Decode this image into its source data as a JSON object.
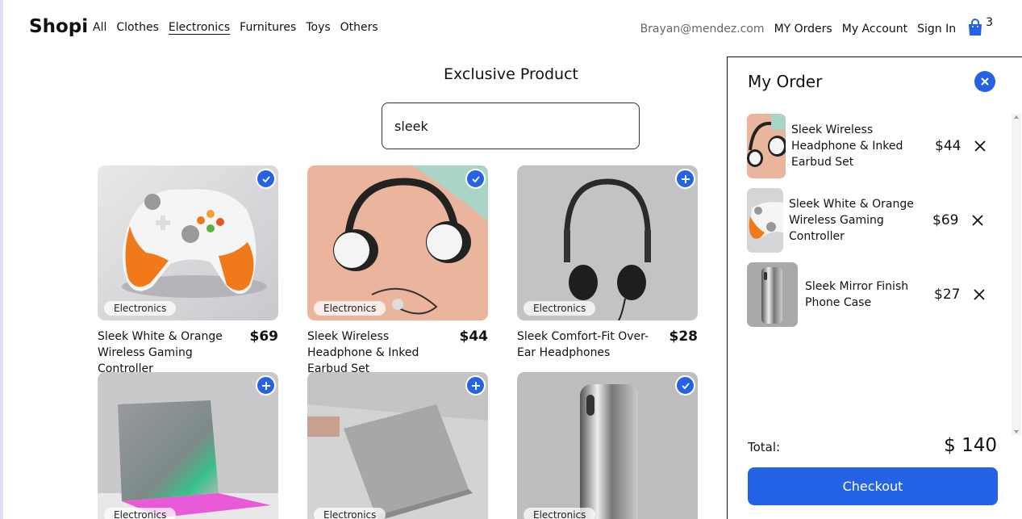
{
  "nav": {
    "logo": "Shopi",
    "links": [
      "All",
      "Clothes",
      "Electronics",
      "Furnitures",
      "Toys",
      "Others"
    ],
    "active_link": "Electronics",
    "email": "Brayan@mendez.com",
    "my_orders": "MY Orders",
    "my_account": "My Account",
    "sign_in": "Sign In",
    "cart_count": "3",
    "cart_icon": "shopping-bag-icon"
  },
  "main": {
    "title": "Exclusive Product",
    "search_value": "sleek"
  },
  "products": [
    {
      "name": "Sleek White & Orange Wireless Gaming Controller",
      "price": "$69",
      "category": "Electronics",
      "in_cart": true
    },
    {
      "name": "Sleek Wireless Headphone & Inked Earbud Set",
      "price": "$44",
      "category": "Electronics",
      "in_cart": true
    },
    {
      "name": "Sleek Comfort-Fit Over-Ear Headphones",
      "price": "$28",
      "category": "Electronics",
      "in_cart": false
    },
    {
      "name": "",
      "price": "",
      "category": "Electronics",
      "in_cart": false
    },
    {
      "name": "",
      "price": "",
      "category": "Electronics",
      "in_cart": false
    },
    {
      "name": "",
      "price": "",
      "category": "Electronics",
      "in_cart": true
    }
  ],
  "order_panel": {
    "title": "My Order",
    "items": [
      {
        "name": "Sleek Wireless Headphone & Inked Earbud Set",
        "price": "$44"
      },
      {
        "name": "Sleek White & Orange Wireless Gaming Controller",
        "price": "$69"
      },
      {
        "name": "Sleek Mirror Finish Phone Case",
        "price": "$27"
      }
    ],
    "total_label": "Total:",
    "total_value": "$ 140",
    "checkout_label": "Checkout"
  },
  "colors": {
    "accent": "#2463e6"
  }
}
